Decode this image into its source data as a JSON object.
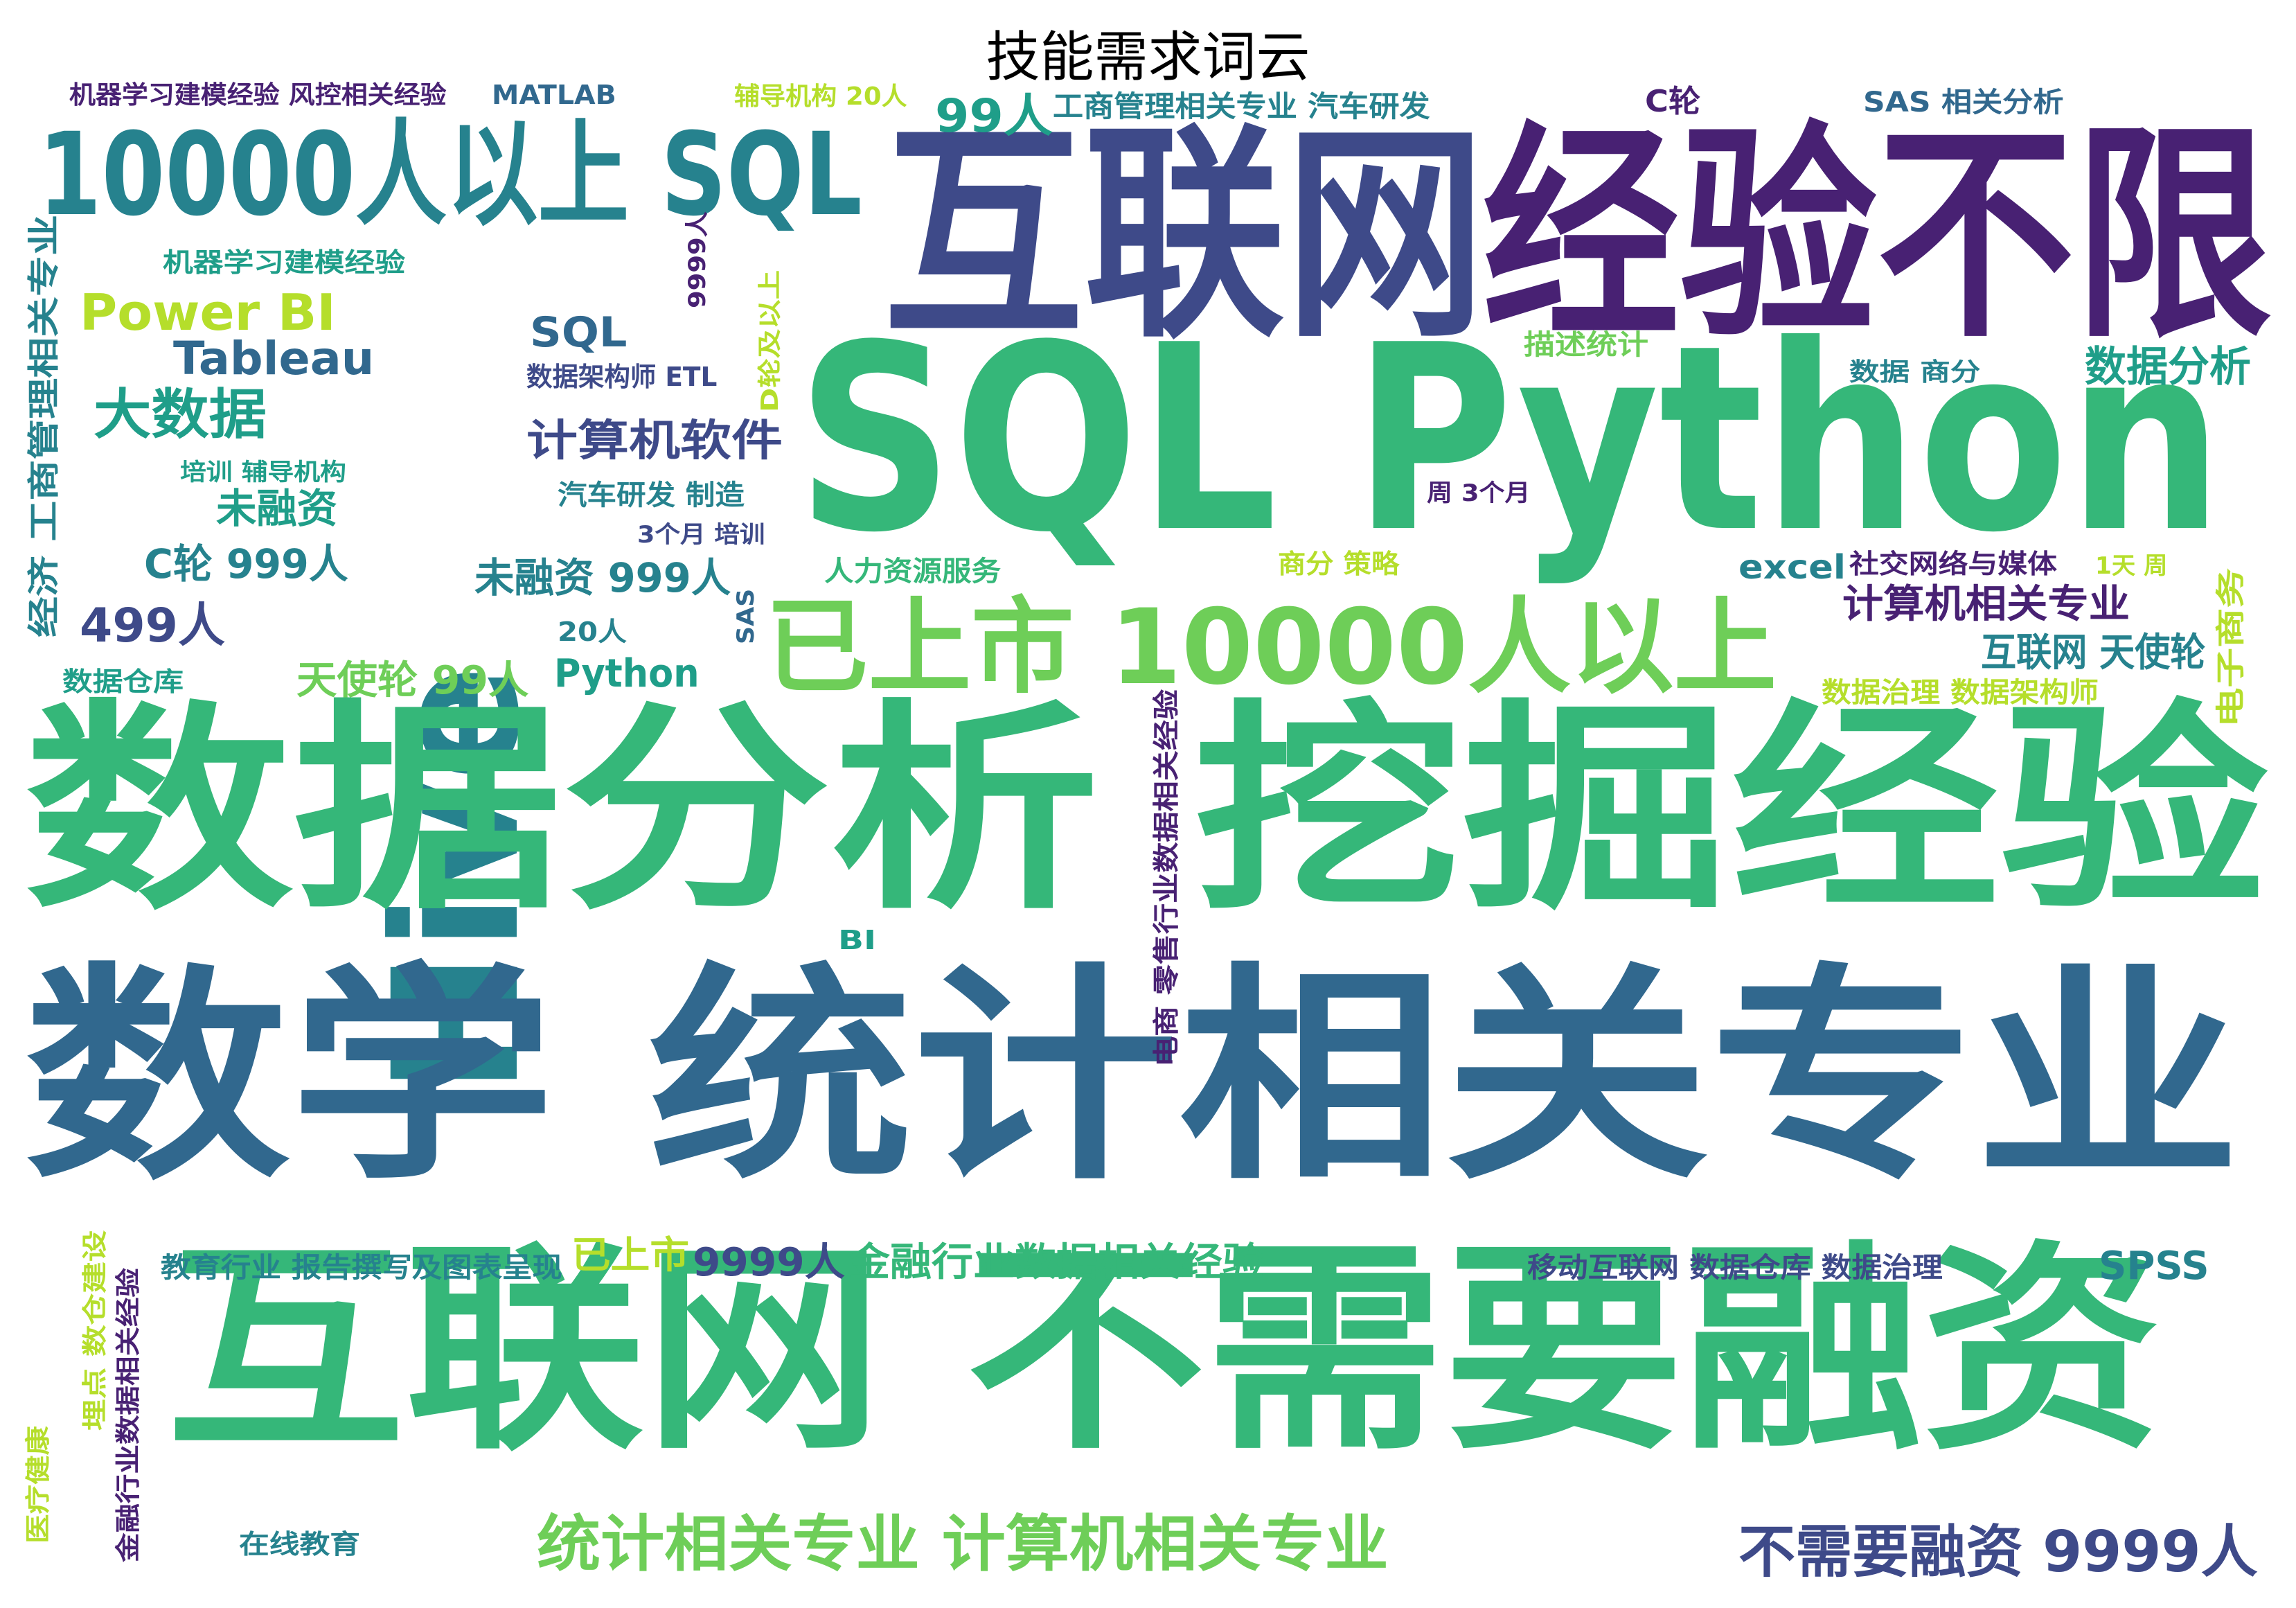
{
  "title": "技能需求词云",
  "palette": {
    "dark_purple": "#482173",
    "indigo": "#3e4a89",
    "slate_blue": "#31688e",
    "teal_blue": "#26828e",
    "teal": "#1f9e89",
    "green": "#35b779",
    "light_green": "#6ece58",
    "lime": "#b5de2b"
  },
  "words": [
    {
      "text": "互联网",
      "color": "#3e4a89",
      "vertical": false
    },
    {
      "text": "经验不限",
      "color": "#482173",
      "vertical": false
    },
    {
      "text": "SQL Python",
      "color": "#35b779",
      "vertical": false
    },
    {
      "text": "Hive",
      "color": "#26828e",
      "vertical": true
    },
    {
      "text": "10000人以上 SQL",
      "color": "#26828e",
      "vertical": false
    },
    {
      "text": "数据分析 挖掘经验",
      "color": "#35b779",
      "vertical": false
    },
    {
      "text": "数学 统计相关专业",
      "color": "#31688e",
      "vertical": false
    },
    {
      "text": "互联网 不需要融资",
      "color": "#35b779",
      "vertical": false
    },
    {
      "text": "已上市 10000人以上",
      "color": "#6ece58",
      "vertical": false
    },
    {
      "text": "统计相关专业 计算机相关专业",
      "color": "#6ece58",
      "vertical": false
    },
    {
      "text": "不需要融资 9999人",
      "color": "#3e4a89",
      "vertical": false
    },
    {
      "text": "金融行业数据相关经验",
      "color": "#35b779",
      "vertical": false
    },
    {
      "text": "9999人",
      "color": "#3e4a89",
      "vertical": false
    },
    {
      "text": "已上市",
      "color": "#b5de2b",
      "vertical": false
    },
    {
      "text": "教育行业 报告撰写及图表呈现",
      "color": "#26828e",
      "vertical": false
    },
    {
      "text": "机器学习建模经验 风控相关经验",
      "color": "#482173",
      "vertical": false
    },
    {
      "text": "MATLAB",
      "color": "#31688e",
      "vertical": false
    },
    {
      "text": "辅导机构 20人",
      "color": "#b5de2b",
      "vertical": false
    },
    {
      "text": "99人",
      "color": "#1f9e89",
      "vertical": false
    },
    {
      "text": "工商管理相关专业 汽车研发",
      "color": "#26828e",
      "vertical": false
    },
    {
      "text": "C轮",
      "color": "#482173",
      "vertical": false
    },
    {
      "text": "SAS 相关分析",
      "color": "#31688e",
      "vertical": false
    },
    {
      "text": "机器学习建模经验",
      "color": "#1f9e89",
      "vertical": false
    },
    {
      "text": "Power BI",
      "color": "#b5de2b",
      "vertical": false
    },
    {
      "text": "Tableau",
      "color": "#31688e",
      "vertical": false
    },
    {
      "text": "SQL",
      "color": "#31688e",
      "vertical": false
    },
    {
      "text": "数据架构师 ETL",
      "color": "#3e4a89",
      "vertical": false
    },
    {
      "text": "大数据",
      "color": "#1f9e89",
      "vertical": false
    },
    {
      "text": "计算机软件",
      "color": "#3e4a89",
      "vertical": false
    },
    {
      "text": "培训 辅导机构",
      "color": "#1f9e89",
      "vertical": false
    },
    {
      "text": "未融资",
      "color": "#1f9e89",
      "vertical": false
    },
    {
      "text": "汽车研发 制造",
      "color": "#26828e",
      "vertical": false
    },
    {
      "text": "3个月 培训",
      "color": "#3e4a89",
      "vertical": false
    },
    {
      "text": "C轮 999人",
      "color": "#26828e",
      "vertical": false
    },
    {
      "text": "未融资 999人",
      "color": "#26828e",
      "vertical": false
    },
    {
      "text": "499人",
      "color": "#3e4a89",
      "vertical": false
    },
    {
      "text": "20人",
      "color": "#26828e",
      "vertical": false
    },
    {
      "text": "人力资源服务",
      "color": "#35b779",
      "vertical": false
    },
    {
      "text": "天使轮 99人",
      "color": "#6ece58",
      "vertical": false
    },
    {
      "text": "Python",
      "color": "#1f9e89",
      "vertical": false
    },
    {
      "text": "数据仓库",
      "color": "#1f9e89",
      "vertical": false
    },
    {
      "text": "描述统计",
      "color": "#6ece58",
      "vertical": false
    },
    {
      "text": "数据 商分",
      "color": "#26828e",
      "vertical": false
    },
    {
      "text": "数据分析",
      "color": "#1f9e89",
      "vertical": false
    },
    {
      "text": "周 3个月",
      "color": "#482173",
      "vertical": false
    },
    {
      "text": "商分 策略",
      "color": "#b5de2b",
      "vertical": false
    },
    {
      "text": "excel",
      "color": "#26828e",
      "vertical": false
    },
    {
      "text": "社交网络与媒体",
      "color": "#482173",
      "vertical": false
    },
    {
      "text": "1天 周",
      "color": "#b5de2b",
      "vertical": false
    },
    {
      "text": "计算机相关专业",
      "color": "#482173",
      "vertical": false
    },
    {
      "text": "互联网 天使轮",
      "color": "#26828e",
      "vertical": false
    },
    {
      "text": "数据治理 数据架构师",
      "color": "#b5de2b",
      "vertical": false
    },
    {
      "text": "SPSS",
      "color": "#26828e",
      "vertical": false
    },
    {
      "text": "移动互联网 数据仓库 数据治理",
      "color": "#3e4a89",
      "vertical": false
    },
    {
      "text": "在线教育",
      "color": "#26828e",
      "vertical": false
    },
    {
      "text": "BI",
      "color": "#1f9e89",
      "vertical": false
    },
    {
      "text": "经济 工商管理相关专业",
      "color": "#26828e",
      "vertical": true
    },
    {
      "text": "9999人",
      "color": "#482173",
      "vertical": true
    },
    {
      "text": "D轮及以上",
      "color": "#b5de2b",
      "vertical": true
    },
    {
      "text": "SAS",
      "color": "#31688e",
      "vertical": true
    },
    {
      "text": "电子商务",
      "color": "#b5de2b",
      "vertical": true
    },
    {
      "text": "电商 零售行业数据相关经验",
      "color": "#482173",
      "vertical": true
    },
    {
      "text": "医疗健康",
      "color": "#b5de2b",
      "vertical": true
    },
    {
      "text": "埋点 数仓建设",
      "color": "#b5de2b",
      "vertical": true
    },
    {
      "text": "金融行业数据相关经验",
      "color": "#482173",
      "vertical": true
    }
  ]
}
